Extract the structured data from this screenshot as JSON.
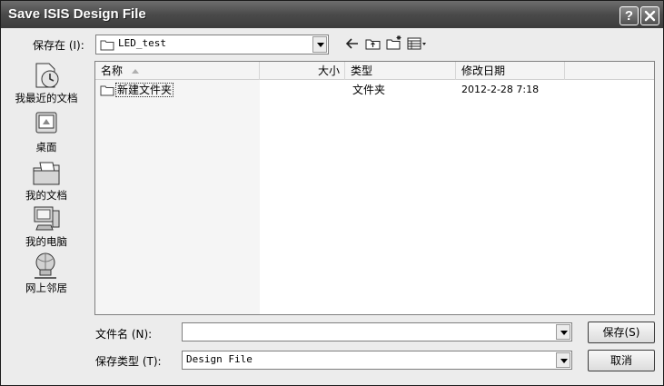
{
  "title": "Save ISIS Design File",
  "title_buttons": {
    "help": "?",
    "close": "X"
  },
  "save_in": {
    "label": "保存在 (I):",
    "value": "LED_test"
  },
  "toolbar": {
    "icons": [
      "back-icon",
      "up-folder-icon",
      "new-folder-icon",
      "views-menu-icon"
    ]
  },
  "places": [
    {
      "label": "我最近的文档",
      "icon": "recent-documents-icon"
    },
    {
      "label": "桌面",
      "icon": "desktop-icon"
    },
    {
      "label": "我的文档",
      "icon": "my-documents-icon"
    },
    {
      "label": "我的电脑",
      "icon": "my-computer-icon"
    },
    {
      "label": "网上邻居",
      "icon": "network-places-icon"
    }
  ],
  "columns": {
    "name": "名称",
    "size": "大小",
    "type": "类型",
    "modified": "修改日期"
  },
  "files": [
    {
      "name": "新建文件夹",
      "size": "",
      "type": "文件夹",
      "modified": "2012-2-28 7:18"
    }
  ],
  "filename": {
    "label": "文件名 (N):",
    "value": ""
  },
  "filetype": {
    "label": "保存类型 (T):",
    "value": "Design File"
  },
  "buttons": {
    "save": "保存(S)",
    "cancel": "取消"
  }
}
